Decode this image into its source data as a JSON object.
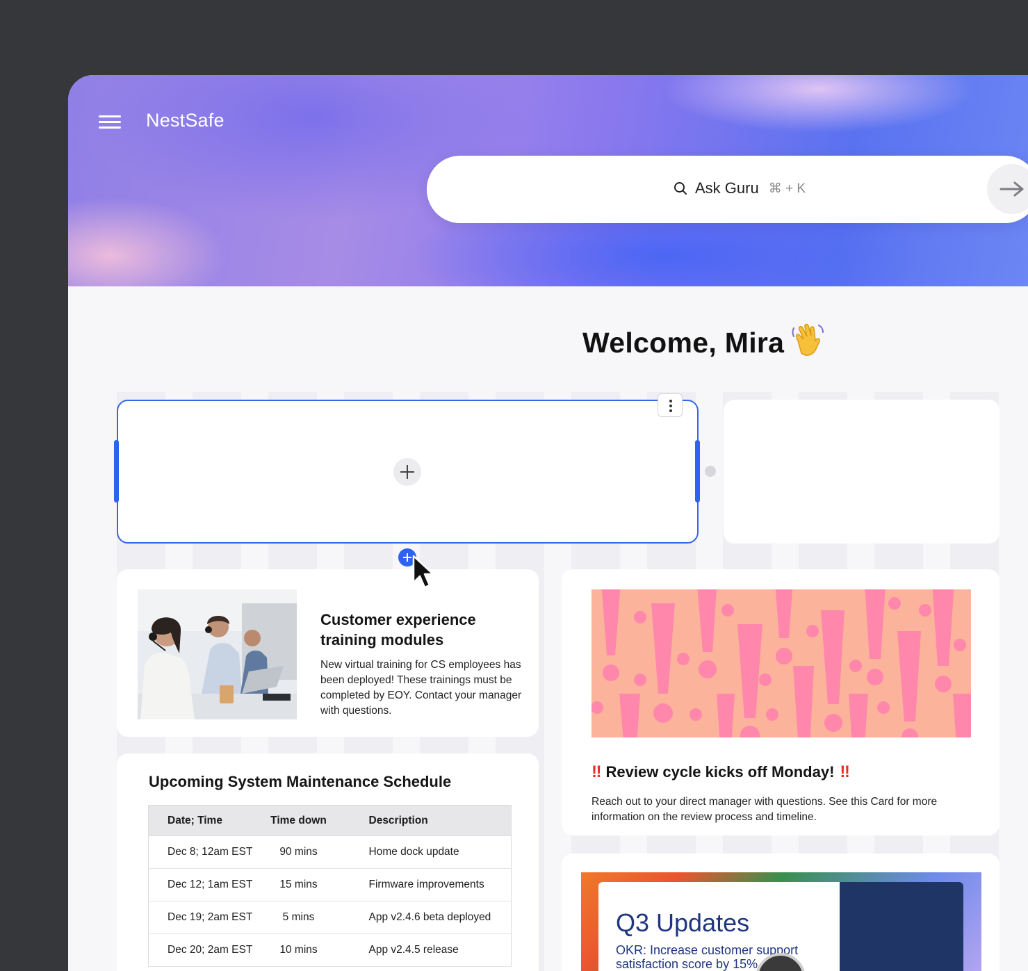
{
  "header": {
    "brand": "NestSafe",
    "search": {
      "label": "Ask Guru",
      "shortcut": "⌘ + K"
    }
  },
  "welcome": {
    "text": "Welcome, Mira",
    "emoji": "👋"
  },
  "cards": {
    "cx_training": {
      "title": "Customer experience training modules",
      "body": "New virtual training for CS employees has been deployed! These trainings must be completed by EOY. Contact your manager with questions."
    },
    "review": {
      "title": "Review cycle kicks off Monday!",
      "emphasis": "‼",
      "body": "Reach out to your direct manager with questions. See this Card for more information on the review process and timeline."
    },
    "maintenance": {
      "title": "Upcoming System Maintenance Schedule",
      "columns": [
        "Date; Time",
        "Time down",
        "Description"
      ],
      "rows": [
        [
          "Dec 8; 12am EST",
          "90 mins",
          "Home dock update"
        ],
        [
          "Dec 12; 1am EST",
          "15 mins",
          "Firmware improvements"
        ],
        [
          "Dec 19; 2am EST",
          "5 mins",
          "App v2.4.6 beta deployed"
        ],
        [
          "Dec 20; 2am EST",
          "10 mins",
          "App v2.4.5 release"
        ]
      ]
    },
    "q3": {
      "title": "Q3 Updates",
      "subtitle": "OKR: Increase customer support satisfaction score by 15%"
    }
  },
  "colors": {
    "accent": "#2d63ee",
    "background": "#f7f6f9",
    "frame": "#36373a",
    "exclamation": "#e5321e",
    "banner_bg": "#fbb39c",
    "banner_marks": "#ff87ab"
  }
}
